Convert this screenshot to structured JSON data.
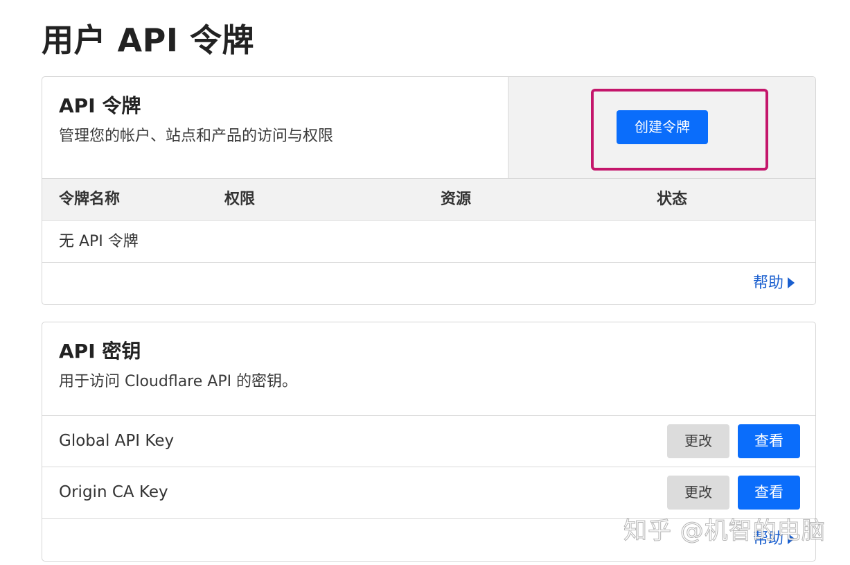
{
  "page": {
    "title": "用户 API 令牌"
  },
  "api_tokens": {
    "title": "API 令牌",
    "description": "管理您的帐户、站点和产品的访问与权限",
    "create_button": "创建令牌",
    "columns": [
      "令牌名称",
      "权限",
      "资源",
      "状态"
    ],
    "empty_text": "无 API 令牌",
    "help_link": "帮助"
  },
  "api_keys": {
    "title": "API 密钥",
    "description": "用于访问 Cloudflare API 的密钥。",
    "rows": [
      {
        "name": "Global API Key",
        "change_label": "更改",
        "view_label": "查看"
      },
      {
        "name": "Origin CA Key",
        "change_label": "更改",
        "view_label": "查看"
      }
    ],
    "help_link": "帮助"
  },
  "watermark": {
    "text": "知乎 @机智的电脑"
  },
  "colors": {
    "primary_button": "#0a6dfb",
    "secondary_button": "#dcdcdc",
    "highlight_border": "#c4166b",
    "link": "#1a5fcf"
  },
  "icons": {
    "help_caret": "caret-right-icon"
  }
}
